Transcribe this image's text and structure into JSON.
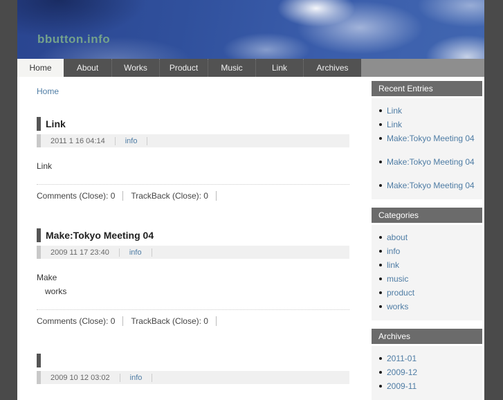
{
  "site": {
    "title": "bbutton.info"
  },
  "nav": {
    "items": [
      {
        "label": "Home",
        "active": true
      },
      {
        "label": "About"
      },
      {
        "label": "Works"
      },
      {
        "label": "Product"
      },
      {
        "label": "Music"
      },
      {
        "label": "Link"
      },
      {
        "label": "Archives"
      }
    ]
  },
  "breadcrumb": {
    "home_label": "Home"
  },
  "entries": [
    {
      "title": "Link",
      "date": "2011 1 16  04:14",
      "info_label": "info",
      "body_line1": "Link",
      "comments_label": "Comments (Close): 0",
      "trackback_label": "TrackBack (Close): 0"
    },
    {
      "title": "Make:Tokyo Meeting 04",
      "date": "2009 11 17  23:40",
      "info_label": "info",
      "body_line1": "Make",
      "body_line2": "works",
      "comments_label": "Comments (Close): 0",
      "trackback_label": "TrackBack (Close): 0"
    },
    {
      "title": "",
      "date": "2009 10 12  03:02",
      "info_label": "info"
    }
  ],
  "sidebar": {
    "recent_entries": {
      "title": "Recent Entries",
      "items": [
        "Link",
        "Link",
        "Make:Tokyo Meeting 04",
        "Make:Tokyo Meeting 04",
        "Make:Tokyo Meeting 04"
      ]
    },
    "categories": {
      "title": "Categories",
      "items": [
        "about",
        "info",
        "link",
        "music",
        "product",
        "works"
      ]
    },
    "archives": {
      "title": "Archives",
      "items": [
        "2011-01",
        "2009-12",
        "2009-11"
      ]
    }
  },
  "colors": {
    "outer_bg": "#4a4a4a",
    "link_blue": "#4e7ca4",
    "header_title_green": "#74a18b",
    "nav_active_bg": "#f4f4f2",
    "nav_inactive_bg": "#525252",
    "nav_filler_bg": "#8e8e8e",
    "sidebar_header_bg": "#6b6b6b",
    "sidebar_list_bg": "#f4f4f4",
    "date_row_bg": "#f0f0f0",
    "entry_bar": "#555555"
  }
}
